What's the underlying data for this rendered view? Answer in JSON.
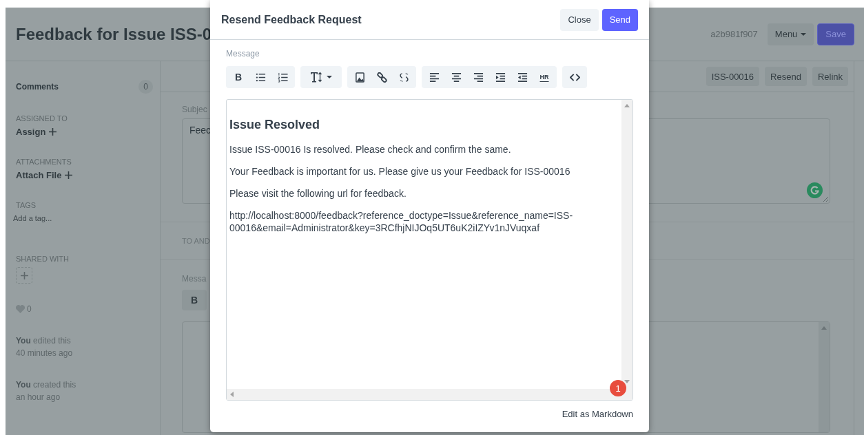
{
  "header": {
    "title": "Feedback for Issue ISS-0",
    "document_id": "a2b981f907",
    "menu_button": "Menu",
    "save_button": "Save"
  },
  "toolbar": {
    "buttons": [
      "ISS-00016",
      "Resend",
      "Relink"
    ]
  },
  "sidebar": {
    "comments": {
      "label": "Comments",
      "count": "0"
    },
    "assigned_to": {
      "heading": "ASSIGNED TO",
      "action": "Assign"
    },
    "attachments": {
      "heading": "ATTACHMENTS",
      "action": "Attach File"
    },
    "tags": {
      "heading": "TAGS",
      "placeholder": "Add a tag..."
    },
    "shared_with": {
      "heading": "SHARED WITH"
    },
    "likes": {
      "count": "0"
    },
    "activity": [
      "**You** edited this 40 minutes ago",
      "**You** created this an hour ago"
    ]
  },
  "form": {
    "subject": {
      "label": "Subjec",
      "value": "Feec"
    },
    "section_heading": "TO AND",
    "message": {
      "label": "Messa",
      "toolbar_button": "B"
    }
  },
  "dialog": {
    "title": "Resend Feedback Request",
    "close_button": "Close",
    "send_button": "Send",
    "message_label": "Message",
    "toolbar": [
      [
        {
          "kind": "bold",
          "label": "B"
        },
        {
          "kind": "bullet-list"
        },
        {
          "kind": "numbered-list"
        }
      ],
      [
        {
          "kind": "font-size"
        }
      ],
      [
        {
          "kind": "image"
        },
        {
          "kind": "link"
        },
        {
          "kind": "unlink"
        }
      ],
      [
        {
          "kind": "align-left"
        },
        {
          "kind": "align-center"
        },
        {
          "kind": "align-right"
        },
        {
          "kind": "indent"
        },
        {
          "kind": "outdent"
        },
        {
          "kind": "hr",
          "label": "HR"
        }
      ],
      [
        {
          "kind": "code"
        }
      ]
    ],
    "editor": {
      "heading": "Issue Resolved",
      "paragraphs": [
        "Issue ISS-00016 Is resolved. Please check and confirm the same.",
        "Your Feedback is important for us. Please give us your Feedback for ISS-00016",
        "Please visit the following url for feedback.",
        "http://localhost:8000/feedback?reference_doctype=Issue&reference_name=ISS-00016&email=Administrator&key=3RCfhjNIJOq5UT6uK2iIZYv1nJVuqxaf"
      ]
    },
    "grammar_badge": "1",
    "markdown_link": "Edit as Markdown"
  }
}
